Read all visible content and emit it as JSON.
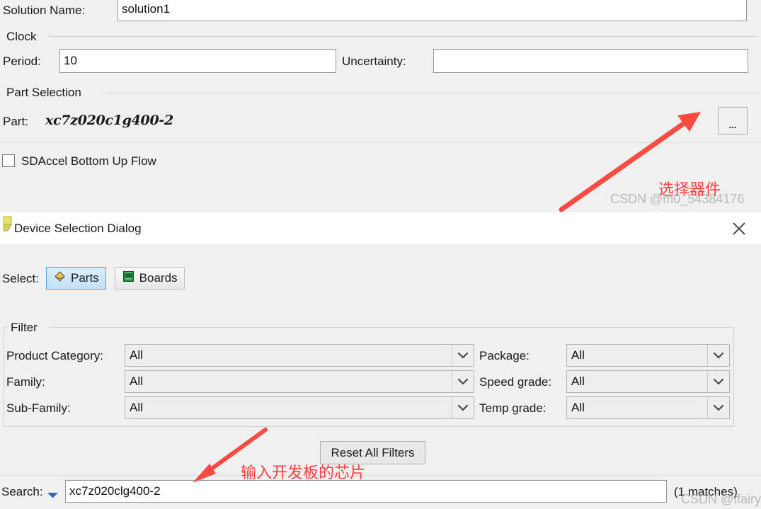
{
  "top_panel": {
    "solution_name_label": "Solution Name:",
    "solution_name_value": "solution1",
    "clock_group_title": "Clock",
    "period_label": "Period:",
    "period_value": "10",
    "uncertainty_label": "Uncertainty:",
    "uncertainty_value": "",
    "part_group_title": "Part Selection",
    "part_label": "Part:",
    "part_value": "xc7z020c1g400-2",
    "browse_button_label": "...",
    "sdaccel_checkbox_label": "SDAccel Bottom Up Flow",
    "sdaccel_checked": false
  },
  "annotations": {
    "select_device_note": "选择器件",
    "enter_chip_note": "输入开发板的芯片",
    "watermark_top": "CSDN @m0_54384176",
    "watermark_bottom": "CSDN @ffairyY",
    "arrow_color": "#fa4b42",
    "note_color": "#ff4040"
  },
  "dialog": {
    "title": "Device Selection Dialog",
    "close_label": "✕",
    "select_label": "Select:",
    "parts_button": "Parts",
    "boards_button": "Boards",
    "selected_mode": "Parts",
    "filter": {
      "group_title": "Filter",
      "rows": [
        {
          "left_label": "Product Category:",
          "left_value": "All",
          "right_label": "Package:",
          "right_value": "All"
        },
        {
          "left_label": "Family:",
          "left_value": "All",
          "right_label": "Speed grade:",
          "right_value": "All"
        },
        {
          "left_label": "Sub-Family:",
          "left_value": "All",
          "right_label": "Temp grade:",
          "right_value": "All"
        }
      ]
    },
    "reset_button": "Reset All Filters",
    "search_label": "Search:",
    "search_value": "xc7z020clg400-2",
    "matches_text": "(1 matches)"
  }
}
